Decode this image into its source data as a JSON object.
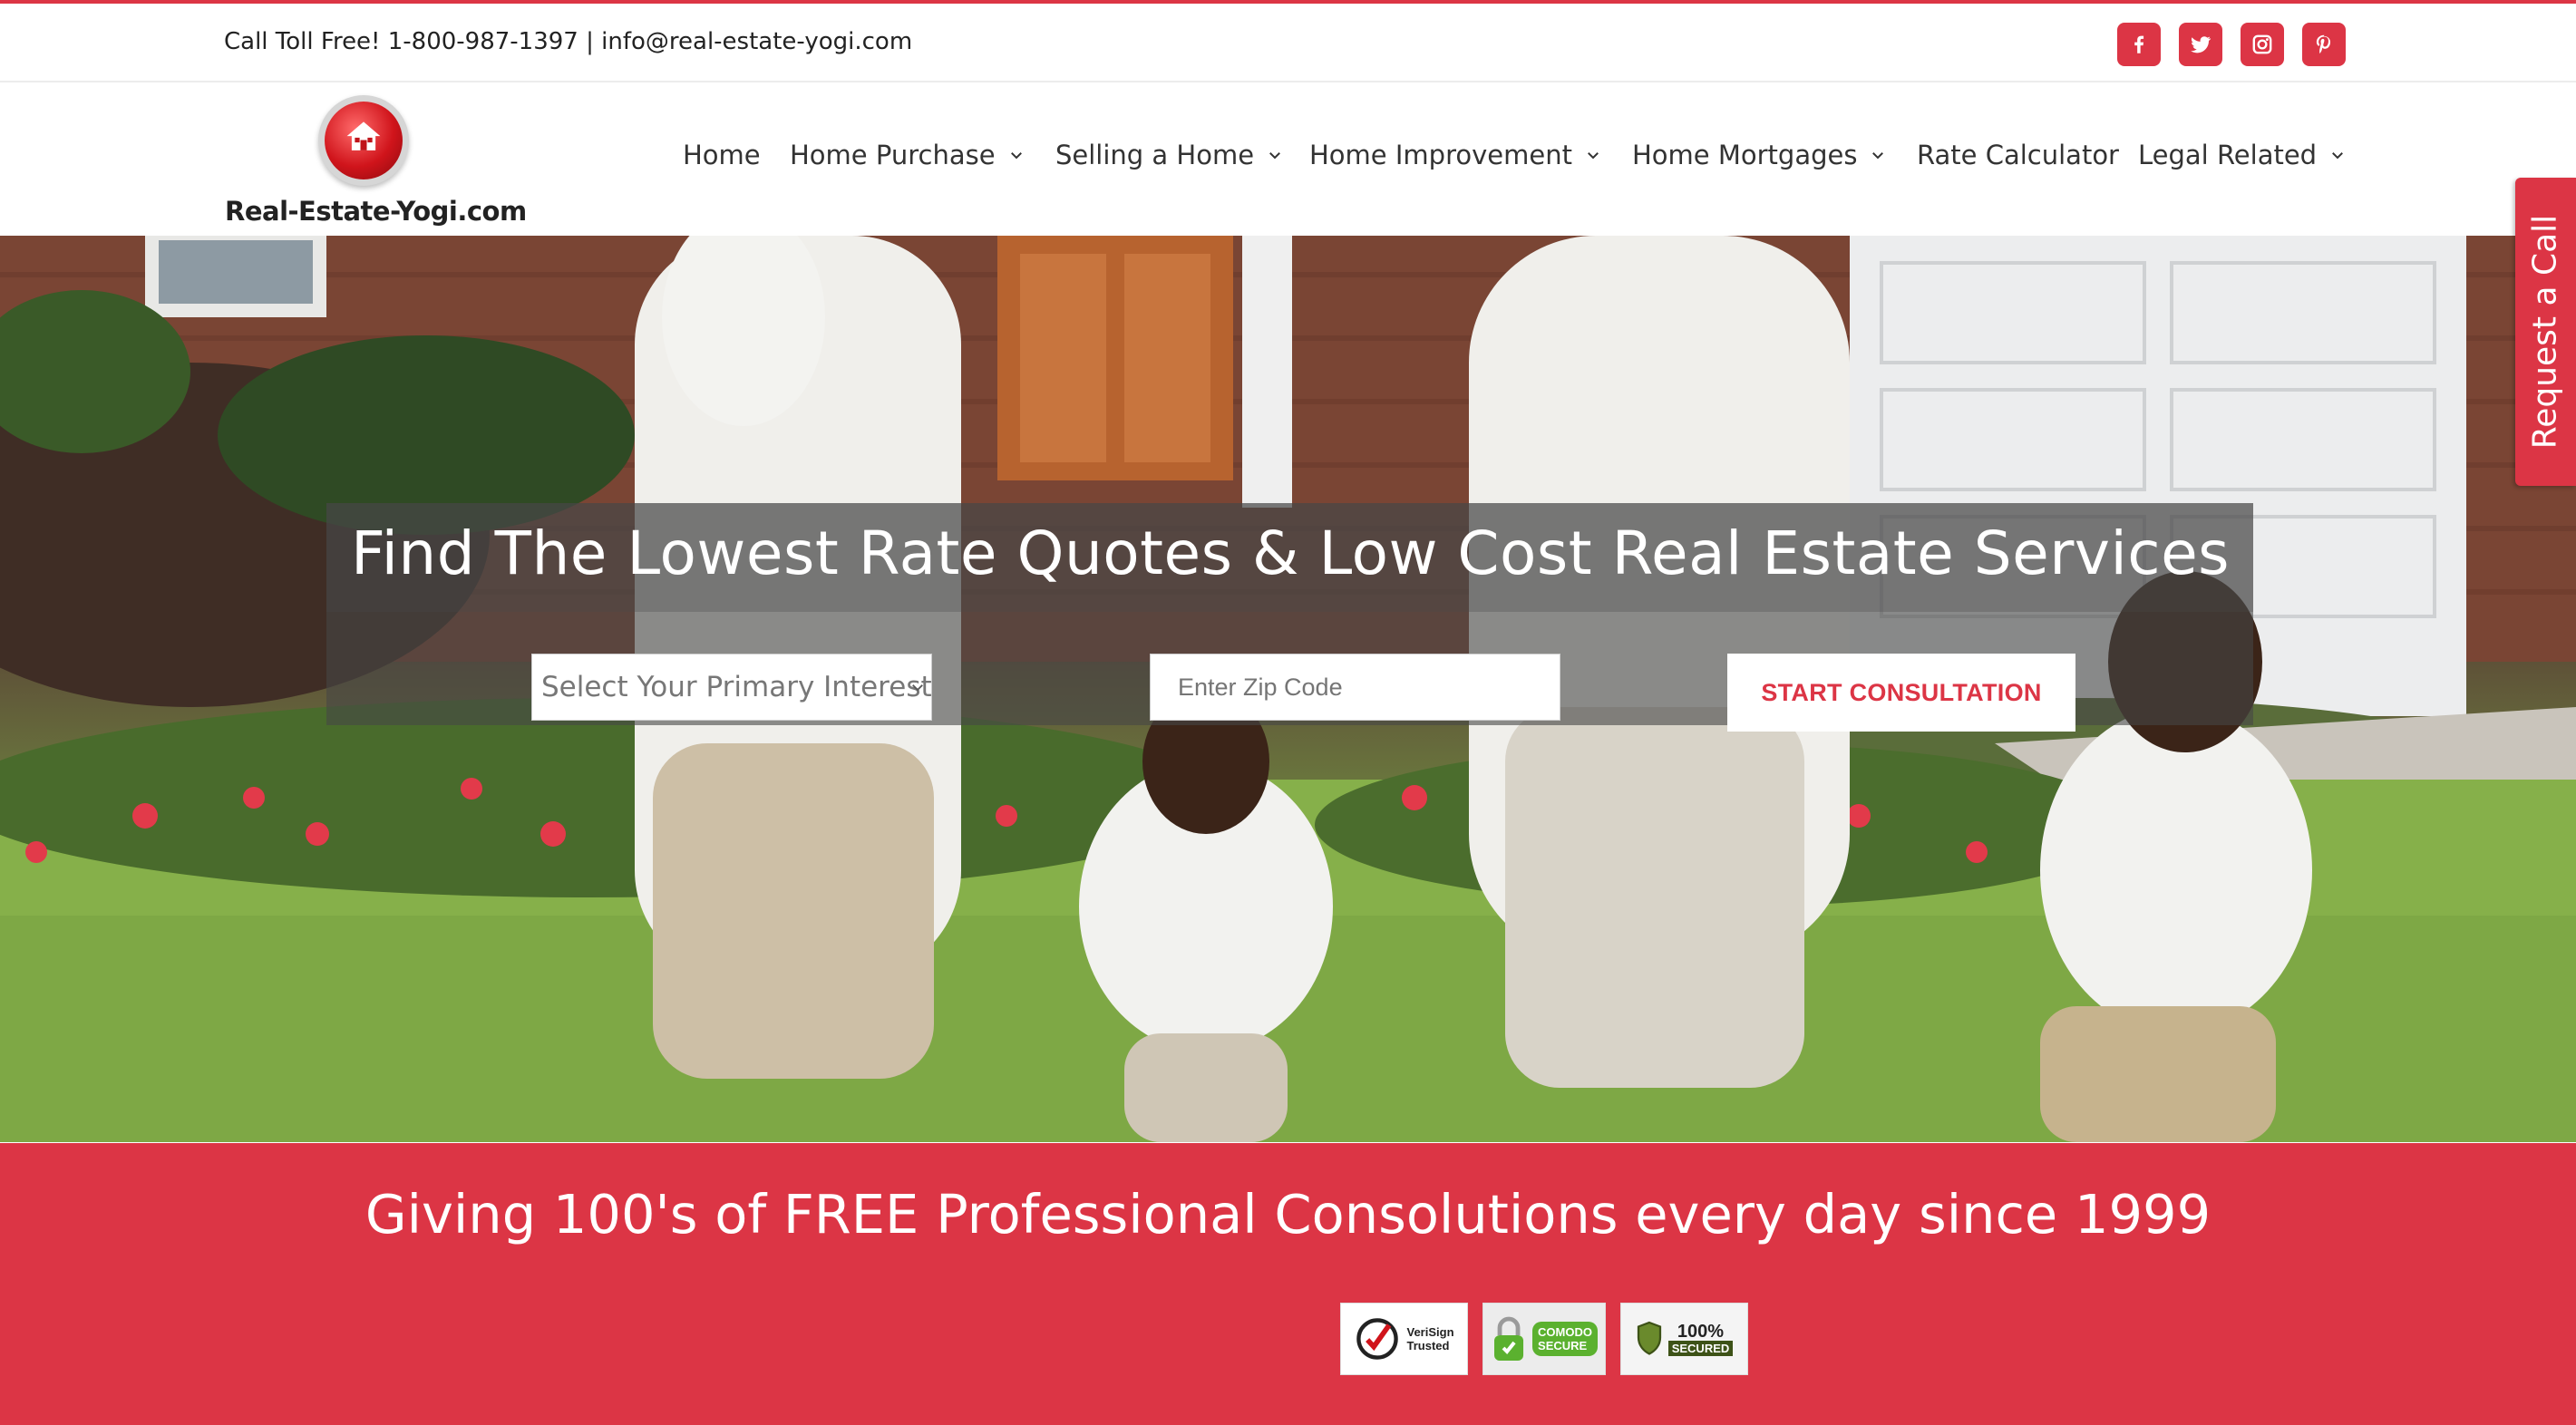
{
  "colors": {
    "brand_red": "#dc3545",
    "text_dark": "#333333"
  },
  "topbar": {
    "contact_text": "Call Toll Free! 1-800-987-1397 | info@real-estate-yogi.com",
    "socials": [
      {
        "icon": "facebook-icon"
      },
      {
        "icon": "twitter-icon"
      },
      {
        "icon": "instagram-icon"
      },
      {
        "icon": "pinterest-icon"
      }
    ]
  },
  "logo": {
    "text": "Real-Estate-Yogi.com",
    "icon": "house-icon"
  },
  "nav": {
    "items": [
      {
        "label": "Home",
        "has_dropdown": false
      },
      {
        "label": "Home Purchase",
        "has_dropdown": true
      },
      {
        "label": "Selling a Home",
        "has_dropdown": true
      },
      {
        "label": "Home Improvement",
        "has_dropdown": true
      },
      {
        "label": "Home Mortgages",
        "has_dropdown": true
      },
      {
        "label": "Rate Calculator",
        "has_dropdown": false
      },
      {
        "label": "Legal Related",
        "has_dropdown": true
      }
    ]
  },
  "hero": {
    "title": "Find The Lowest Rate Quotes & Low Cost Real Estate Services",
    "interest_select": {
      "value": "Select Your Primary Interest"
    },
    "zip_input": {
      "placeholder": "Enter Zip Code",
      "value": ""
    },
    "cta_label": "START CONSULTATION"
  },
  "side_tab": {
    "label": "Request a Call"
  },
  "band": {
    "headline": "Giving 100's of FREE Professional Consolutions every day since 1999",
    "badges": [
      {
        "icon": "verisign-check-icon",
        "line1": "VeriSign",
        "line2": "Trusted"
      },
      {
        "icon": "comodo-lock-icon",
        "line1": "COMODO",
        "line2": "SECURE"
      },
      {
        "icon": "shield-icon",
        "line1": "100%",
        "line2": "SECURED"
      }
    ]
  }
}
